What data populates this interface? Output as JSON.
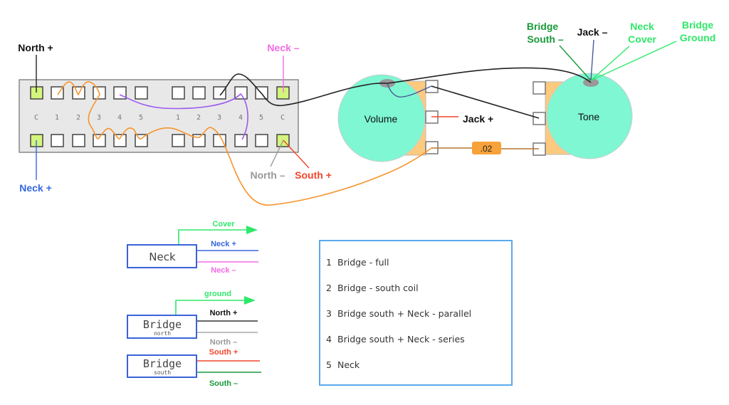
{
  "switch": {
    "position_labels_left": [
      "C",
      "1",
      "2",
      "3",
      "4",
      "5"
    ],
    "position_labels_right": [
      "1",
      "2",
      "3",
      "4",
      "5",
      "C"
    ]
  },
  "callouts": {
    "north_plus": "North +",
    "neck_plus": "Neck +",
    "neck_minus": "Neck –",
    "north_minus": "North –",
    "south_plus": "South +",
    "jack_plus": "Jack +",
    "jack_minus": "Jack –",
    "bridge_south_minus": [
      "Bridge",
      "South –"
    ],
    "neck_cover": [
      "Neck",
      "Cover"
    ],
    "bridge_ground": [
      "Bridge",
      "Ground"
    ]
  },
  "pots": {
    "volume": "Volume",
    "tone": "Tone"
  },
  "capacitor": {
    "value": ".02"
  },
  "pickup_legend": {
    "neck": {
      "name": "Neck",
      "cover": "Cover",
      "plus": "Neck +",
      "minus": "Neck –"
    },
    "bridge_north": {
      "name": "Bridge",
      "sub": "north",
      "ground": "ground",
      "plus": "North +",
      "minus": "North –"
    },
    "bridge_south": {
      "name": "Bridge",
      "sub": "south",
      "plus": "South +",
      "minus": "South –"
    }
  },
  "positions_legend": [
    {
      "num": "1",
      "label": "Bridge - full"
    },
    {
      "num": "2",
      "label": "Bridge - south coil"
    },
    {
      "num": "3",
      "label": "Bridge south + Neck - parallel"
    },
    {
      "num": "4",
      "label": "Bridge south + Neck - series"
    },
    {
      "num": "5",
      "label": "Neck"
    }
  ],
  "colors": {
    "orange_wire": "#f7942e",
    "purple_wire": "#9b59f0",
    "black_wire": "#222222",
    "pot_fill": "#7ef7d2",
    "pot_lug_fill": "#fcca7e",
    "terminal_green": "#d4f57c",
    "neck_plus_blue": "#3567e0",
    "neck_minus_pink": "#f36be6",
    "cover_green": "#2fe86a",
    "south_plus_red": "#f2452a",
    "south_minus_green": "#1a9a3a",
    "north_minus_gray": "#999999",
    "cap_orange": "#f7a23a",
    "legend_border": "#5aa9ec",
    "pickup_border": "#3a63d8"
  }
}
